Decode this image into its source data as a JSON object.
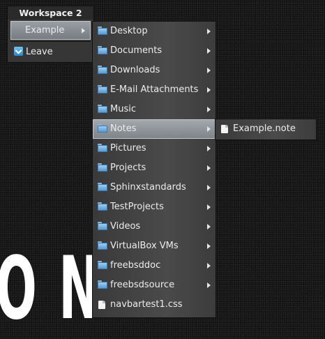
{
  "background": {
    "text": "O N A"
  },
  "root_menu": {
    "title": "Workspace 2",
    "items": [
      {
        "label": "Example",
        "icon": null,
        "selected": true,
        "has_submenu": true
      },
      {
        "label": "Leave",
        "icon": "leave-icon",
        "selected": false,
        "has_submenu": false
      }
    ]
  },
  "example_menu": {
    "items": [
      {
        "label": "Desktop",
        "icon": "folder-icon",
        "has_submenu": true
      },
      {
        "label": "Documents",
        "icon": "folder-icon",
        "has_submenu": true
      },
      {
        "label": "Downloads",
        "icon": "folder-icon",
        "has_submenu": true
      },
      {
        "label": "E-Mail Attachments",
        "icon": "folder-icon",
        "has_submenu": true
      },
      {
        "label": "Music",
        "icon": "folder-icon",
        "has_submenu": true
      },
      {
        "label": "Notes",
        "icon": "folder-icon",
        "has_submenu": true,
        "selected": true
      },
      {
        "label": "Pictures",
        "icon": "folder-icon",
        "has_submenu": true
      },
      {
        "label": "Projects",
        "icon": "folder-icon",
        "has_submenu": true
      },
      {
        "label": "Sphinxstandards",
        "icon": "folder-icon",
        "has_submenu": true
      },
      {
        "label": "TestProjects",
        "icon": "folder-icon",
        "has_submenu": true
      },
      {
        "label": "Videos",
        "icon": "folder-icon",
        "has_submenu": true
      },
      {
        "label": "VirtualBox VMs",
        "icon": "folder-icon",
        "has_submenu": true
      },
      {
        "label": "freebsddoc",
        "icon": "folder-icon",
        "has_submenu": true
      },
      {
        "label": "freebsdsource",
        "icon": "folder-icon",
        "has_submenu": true
      },
      {
        "label": "navbartest1.css",
        "icon": "file-icon",
        "has_submenu": false
      }
    ]
  },
  "notes_menu": {
    "items": [
      {
        "label": "Example.note",
        "icon": "file-icon",
        "has_submenu": false
      }
    ]
  },
  "colors": {
    "menu_bg": "#454545",
    "selection": "#8d9399",
    "folder_icon": "#6aa9dd",
    "text": "#ececec"
  }
}
